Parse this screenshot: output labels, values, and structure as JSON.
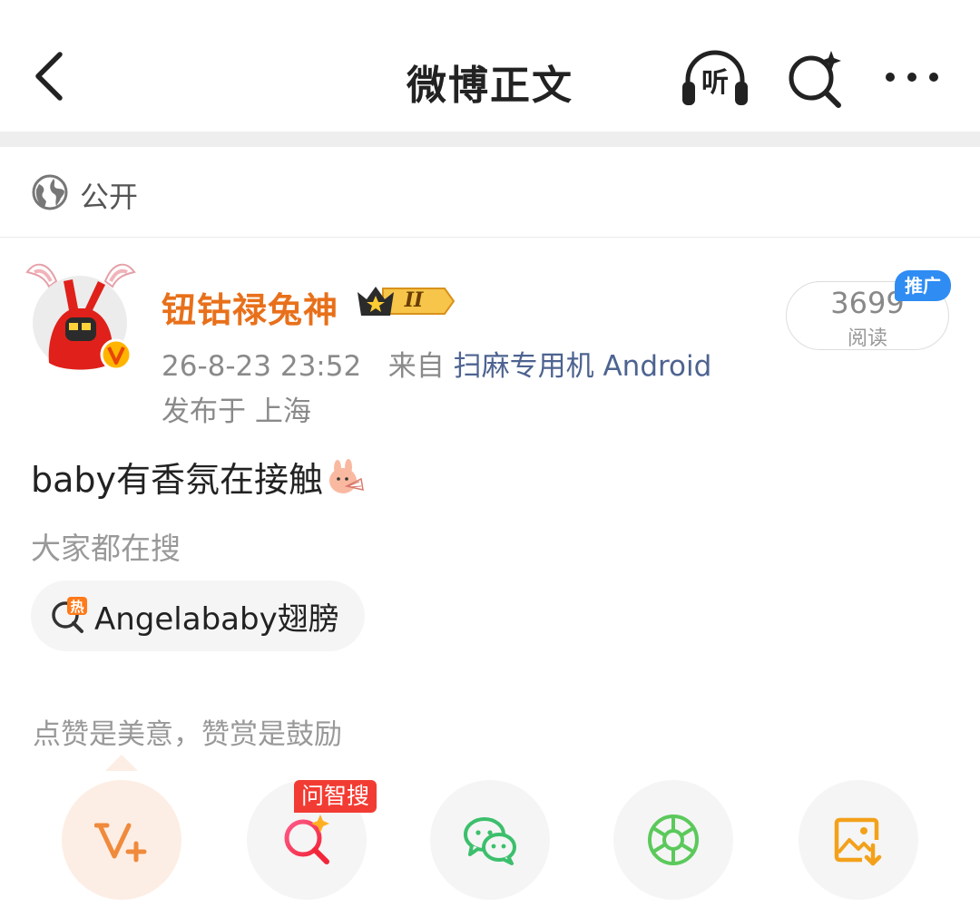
{
  "header": {
    "title": "微博正文",
    "listen_label": "听"
  },
  "visibility": {
    "label": "公开"
  },
  "post": {
    "author": {
      "name": "钮钴禄兔神",
      "level": "II",
      "verified_badge": "V"
    },
    "time": "26-8-23 23:52",
    "source_prefix": "来自",
    "source": "扫麻专用机 Android",
    "location": "发布于 上海",
    "reads": {
      "count": "3699",
      "label": "阅读",
      "promo_tag": "推广"
    },
    "text": "baby有香氛在接触",
    "emoji": "rabbit-fan-emoji"
  },
  "search_hint": {
    "label": "大家都在搜",
    "chip": {
      "icon": "hot-search-icon",
      "icon_text": "热",
      "text": "Angelababy翅膀"
    }
  },
  "reward": {
    "hint": "点赞是美意，赞赏是鼓励",
    "ask_badge": "问智搜"
  },
  "actions": [
    {
      "name": "vplus-button",
      "icon": "v-plus-icon",
      "color": "#f08a3c"
    },
    {
      "name": "ask-search-button",
      "icon": "ai-search-icon",
      "color": "#f23c5a"
    },
    {
      "name": "wechat-share-button",
      "icon": "wechat-icon",
      "color": "#3cbf6c"
    },
    {
      "name": "moments-share-button",
      "icon": "moments-icon",
      "color": "#5bc95b"
    },
    {
      "name": "save-image-button",
      "icon": "save-image-icon",
      "color": "#f3a11a"
    }
  ],
  "colors": {
    "accent_orange": "#e8701a",
    "link_blue": "#4d6390",
    "promo_blue": "#2f8cf3",
    "badge_red": "#f23c33"
  }
}
